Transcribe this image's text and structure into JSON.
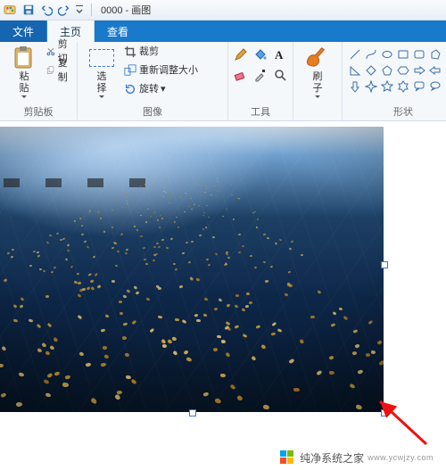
{
  "titlebar": {
    "doc_name": "0000",
    "app_name": "画图"
  },
  "tabs": {
    "file": "文件",
    "home": "主页",
    "view": "查看"
  },
  "ribbon": {
    "clipboard": {
      "paste": "粘\n贴",
      "cut": "剪切",
      "copy": "复制",
      "group": "剪贴板"
    },
    "image": {
      "select": "选\n择",
      "crop": "裁剪",
      "resize": "重新调整大小",
      "rotate": "旋转",
      "group": "图像"
    },
    "tools": {
      "group": "工具"
    },
    "brushes": {
      "label": "刷\n子",
      "group": ""
    },
    "shapes": {
      "group": "形状"
    }
  },
  "icons": {
    "app": "paint-app-icon",
    "save": "save-icon",
    "undo": "undo-icon",
    "redo": "redo-icon",
    "qat_more": "qat-dropdown-icon",
    "paste": "clipboard-icon",
    "scissors": "scissors-icon",
    "copy": "copy-pages-icon",
    "select": "select-dashed-icon",
    "crop": "crop-icon",
    "resize": "resize-icon",
    "rotate": "rotate-icon",
    "pencil": "pencil-icon",
    "bucket": "bucket-icon",
    "text": "text-icon",
    "eraser": "eraser-icon",
    "picker": "color-picker-icon",
    "magnifier": "magnifier-icon",
    "brush": "brush-icon"
  },
  "watermark": {
    "brand": "纯净系统之家",
    "url": "www.ycwjzy.com"
  }
}
